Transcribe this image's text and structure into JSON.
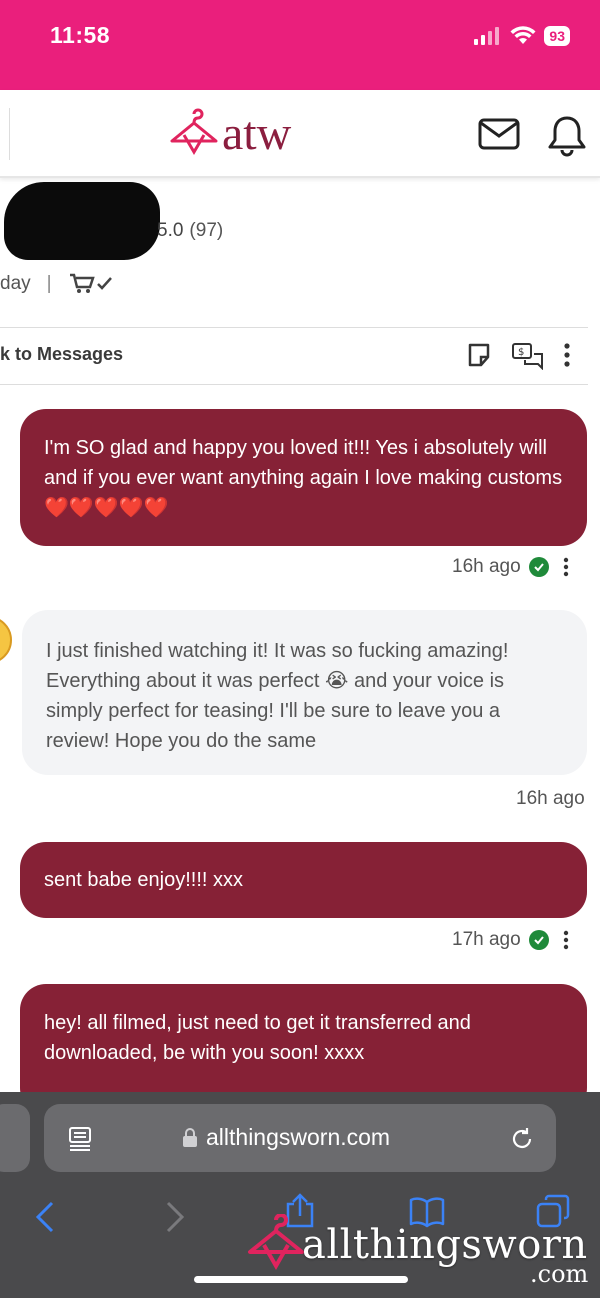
{
  "status_bar": {
    "time": "11:58",
    "battery": "93",
    "background": "#ea1f7c"
  },
  "header": {
    "logo_text": "atw",
    "icons": [
      "mail-icon",
      "bell-icon"
    ],
    "brand_color": "#8b1e3f"
  },
  "seller": {
    "rating": "5.0",
    "rating_count": "(97)",
    "last_seen": "day"
  },
  "thread": {
    "back_label": "k to Messages"
  },
  "messages": [
    {
      "direction": "out",
      "text": "I'm SO glad and happy you loved it!!! Yes i absolutely will and if you ever want anything again I love making customs ❤️❤️❤️❤️❤️",
      "time": "16h ago",
      "read": true
    },
    {
      "direction": "in",
      "text": "I just finished watching it! It was so fucking amazing! Everything about it was perfect 😭 and your voice is simply perfect for teasing! I'll be sure to leave you a review! Hope you do the same",
      "time": "16h ago"
    },
    {
      "direction": "out",
      "text": "sent babe enjoy!!!! xxx",
      "time": "17h ago",
      "read": true
    },
    {
      "direction": "out",
      "text": "hey! all filmed, just need to get it transferred and downloaded, be with you soon! xxxx"
    }
  ],
  "browser": {
    "url": "allthingsworn.com"
  },
  "watermark": {
    "text": "allthingsworn",
    "suffix": ".com"
  },
  "colors": {
    "outgoing_bubble": "#862136",
    "incoming_bubble": "#f3f4f6",
    "read_check": "#1f8a3a",
    "ios_blue": "#3b82f6"
  }
}
